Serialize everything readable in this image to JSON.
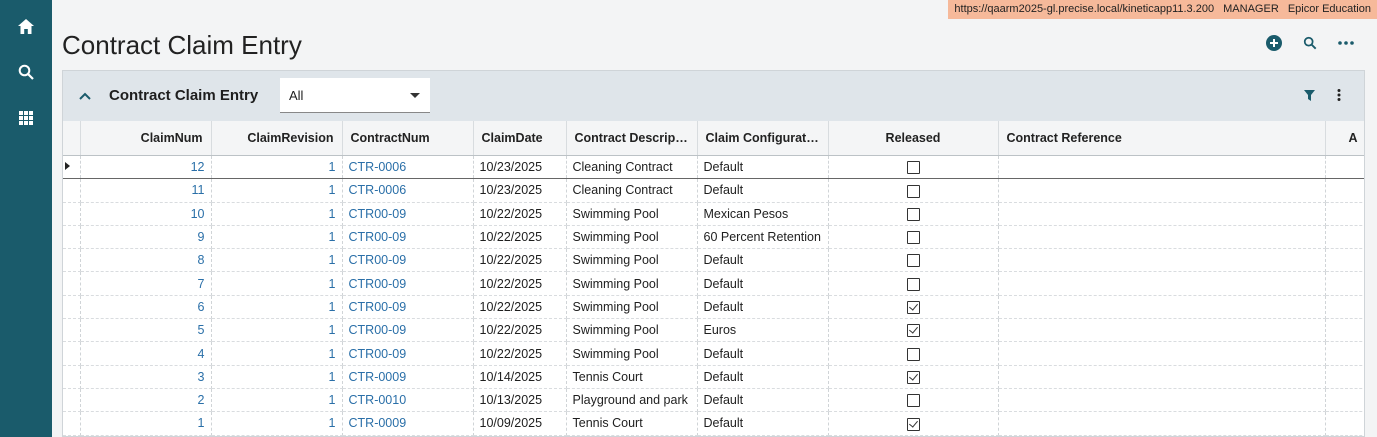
{
  "environment": {
    "url": "https://qaarm2025-gl.precise.local/kineticapp11.3.200",
    "user": "MANAGER",
    "company": "Epicor Education"
  },
  "nav": {
    "items": [
      "home-icon",
      "search-icon",
      "apps-grid-icon"
    ]
  },
  "page": {
    "title": "Contract Claim Entry"
  },
  "top_actions": {
    "icons": [
      "add-circle-icon",
      "search-icon",
      "more-horizontal-icon"
    ]
  },
  "panel": {
    "title": "Contract Claim Entry",
    "filter_value": "All",
    "tools": [
      "filter-icon",
      "more-vertical-icon"
    ]
  },
  "grid": {
    "columns": [
      "ClaimNum",
      "ClaimRevision",
      "ContractNum",
      "ClaimDate",
      "Contract Descript...",
      "Claim Configuration",
      "Released",
      "Contract Reference",
      "A"
    ],
    "rows": [
      {
        "claim_num": "12",
        "revision": "1",
        "contract_num": "CTR-0006",
        "date": "10/23/2025",
        "description": "Cleaning Contract",
        "config": "Default",
        "released": false,
        "reference": ""
      },
      {
        "claim_num": "11",
        "revision": "1",
        "contract_num": "CTR-0006",
        "date": "10/23/2025",
        "description": "Cleaning Contract",
        "config": "Default",
        "released": false,
        "reference": ""
      },
      {
        "claim_num": "10",
        "revision": "1",
        "contract_num": "CTR00-09",
        "date": "10/22/2025",
        "description": "Swimming Pool",
        "config": "Mexican Pesos",
        "released": false,
        "reference": ""
      },
      {
        "claim_num": "9",
        "revision": "1",
        "contract_num": "CTR00-09",
        "date": "10/22/2025",
        "description": "Swimming Pool",
        "config": "60 Percent Retention",
        "released": false,
        "reference": ""
      },
      {
        "claim_num": "8",
        "revision": "1",
        "contract_num": "CTR00-09",
        "date": "10/22/2025",
        "description": "Swimming Pool",
        "config": "Default",
        "released": false,
        "reference": ""
      },
      {
        "claim_num": "7",
        "revision": "1",
        "contract_num": "CTR00-09",
        "date": "10/22/2025",
        "description": "Swimming Pool",
        "config": "Default",
        "released": false,
        "reference": ""
      },
      {
        "claim_num": "6",
        "revision": "1",
        "contract_num": "CTR00-09",
        "date": "10/22/2025",
        "description": "Swimming Pool",
        "config": "Default",
        "released": true,
        "reference": ""
      },
      {
        "claim_num": "5",
        "revision": "1",
        "contract_num": "CTR00-09",
        "date": "10/22/2025",
        "description": "Swimming Pool",
        "config": "Euros",
        "released": true,
        "reference": ""
      },
      {
        "claim_num": "4",
        "revision": "1",
        "contract_num": "CTR00-09",
        "date": "10/22/2025",
        "description": "Swimming Pool",
        "config": "Default",
        "released": false,
        "reference": ""
      },
      {
        "claim_num": "3",
        "revision": "1",
        "contract_num": "CTR-0009",
        "date": "10/14/2025",
        "description": "Tennis Court",
        "config": "Default",
        "released": true,
        "reference": ""
      },
      {
        "claim_num": "2",
        "revision": "1",
        "contract_num": "CTR-0010",
        "date": "10/13/2025",
        "description": "Playground and park",
        "config": "Default",
        "released": false,
        "reference": ""
      },
      {
        "claim_num": "1",
        "revision": "1",
        "contract_num": "CTR-0009",
        "date": "10/09/2025",
        "description": "Tennis Court",
        "config": "Default",
        "released": true,
        "reference": ""
      }
    ]
  },
  "colors": {
    "rail": "#1a5b6b",
    "link": "#2a6fa8",
    "banner": "#f6b99a"
  }
}
